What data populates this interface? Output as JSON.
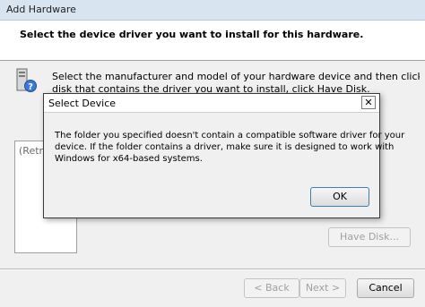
{
  "window": {
    "title": "Add Hardware",
    "heading": "Select the device driver you want to install for this hardware.",
    "instructions": [
      "Select the manufacturer and model of your hardware device and then click Next. If you have a",
      "disk that contains the driver you want to install, click Have Disk."
    ],
    "list_placeholder": "(Retri",
    "have_disk_label": "Have Disk...",
    "back_label": "< Back",
    "next_label": "Next >",
    "cancel_label": "Cancel"
  },
  "dialog": {
    "title": "Select Device",
    "close_label": "✕",
    "message_lines": [
      "The folder you specified doesn't contain a compatible software driver for your",
      "device. If the folder contains a driver, make sure it is designed to work with",
      "Windows for x64-based systems."
    ],
    "ok_label": "OK"
  },
  "icons": {
    "computer": "computer-question-icon",
    "close": "close-icon"
  }
}
